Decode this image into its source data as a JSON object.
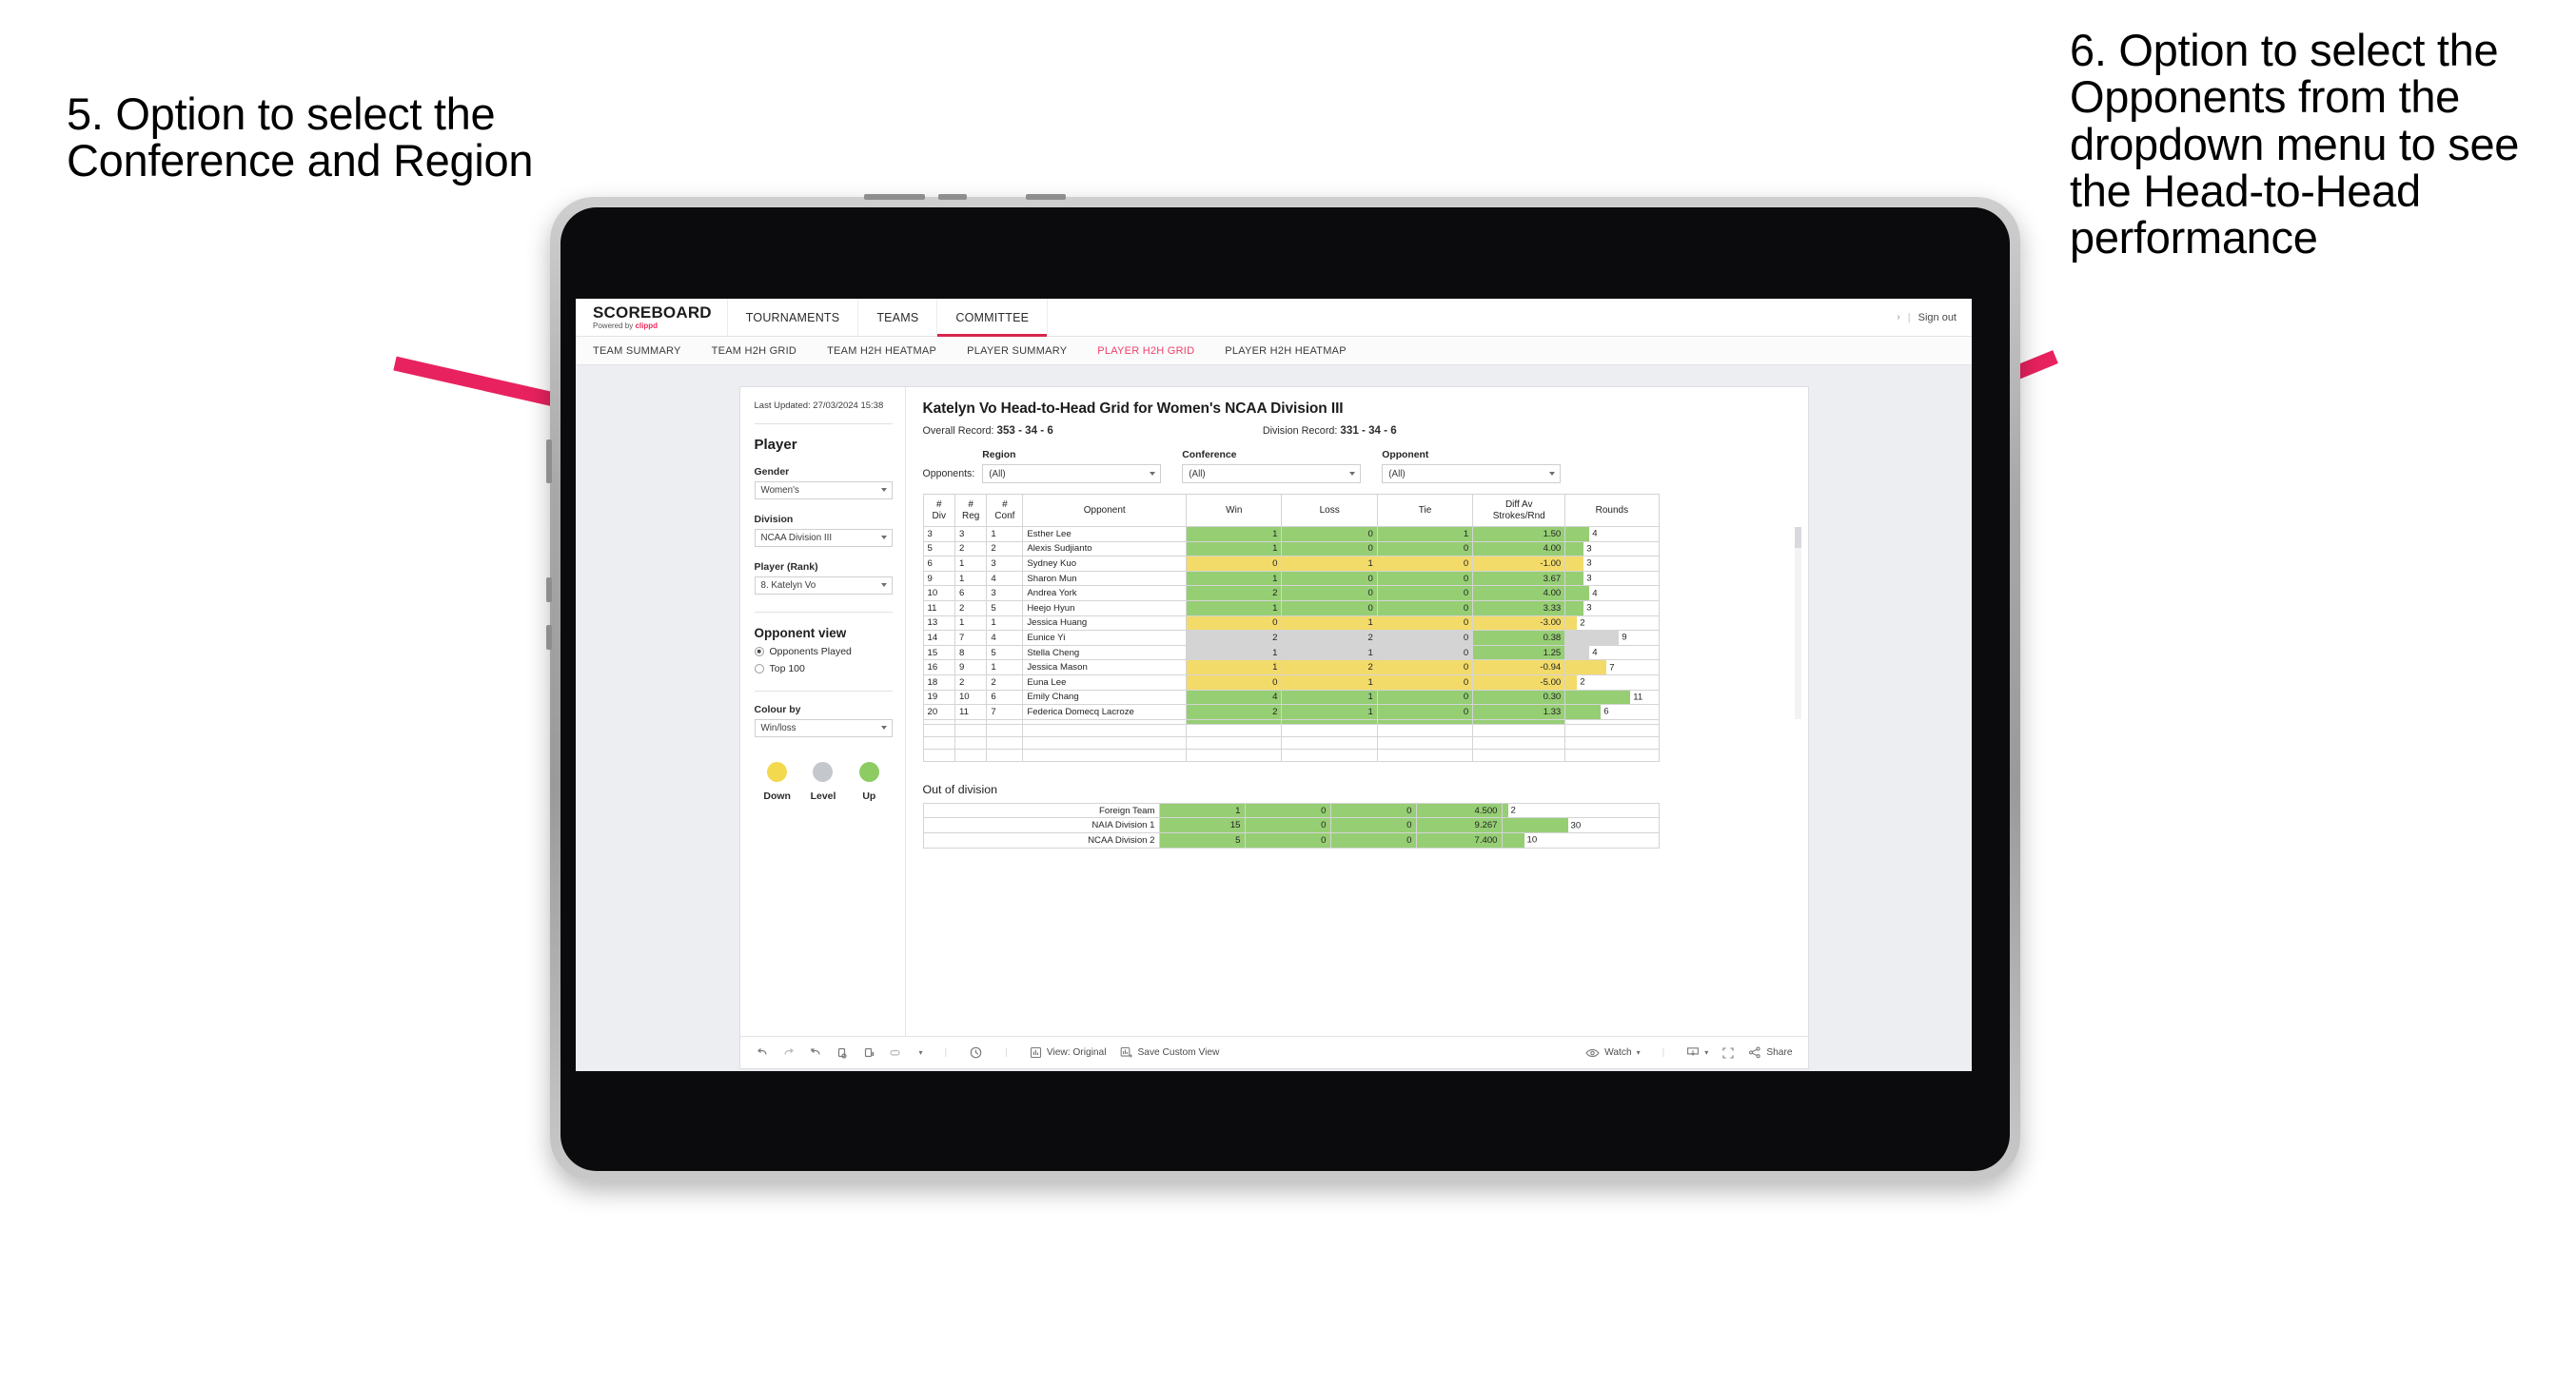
{
  "annotations": {
    "left": "5. Option to select the Conference and Region",
    "right": "6. Option to select the Opponents from the dropdown menu to see the Head-to-Head performance",
    "arrow_color": "#E8225E"
  },
  "app": {
    "brand": {
      "name": "SCOREBOARD",
      "powered_prefix": "Powered by ",
      "powered_by": "clippd"
    },
    "top_nav": [
      {
        "label": "TOURNAMENTS",
        "active": false
      },
      {
        "label": "TEAMS",
        "active": false
      },
      {
        "label": "COMMITTEE",
        "active": true
      }
    ],
    "top_right": {
      "chevron": "›",
      "separator": "|",
      "sign_out": "Sign out"
    },
    "sub_nav": [
      {
        "label": "TEAM SUMMARY",
        "active": false
      },
      {
        "label": "TEAM H2H GRID",
        "active": false
      },
      {
        "label": "TEAM H2H HEATMAP",
        "active": false
      },
      {
        "label": "PLAYER SUMMARY",
        "active": false
      },
      {
        "label": "PLAYER H2H GRID",
        "active": true
      },
      {
        "label": "PLAYER H2H HEATMAP",
        "active": false
      }
    ]
  },
  "sidebar": {
    "last_updated": "Last Updated: 27/03/2024 15:38",
    "heading": "Player",
    "gender": {
      "label": "Gender",
      "value": "Women's"
    },
    "division": {
      "label": "Division",
      "value": "NCAA Division III"
    },
    "player_rank": {
      "label": "Player (Rank)",
      "value": "8. Katelyn Vo"
    },
    "opponent_view": {
      "heading": "Opponent view",
      "options": [
        {
          "label": "Opponents Played",
          "selected": true
        },
        {
          "label": "Top 100",
          "selected": false
        }
      ]
    },
    "colour_by": {
      "label": "Colour by",
      "value": "Win/loss"
    },
    "legend": [
      {
        "label": "Down",
        "color": "#F2D94E"
      },
      {
        "label": "Level",
        "color": "#C4C7CB"
      },
      {
        "label": "Up",
        "color": "#8DCC62"
      }
    ]
  },
  "main": {
    "title": "Katelyn Vo Head-to-Head Grid for Women's NCAA Division III",
    "overall_record": {
      "label": "Overall Record: ",
      "value": "353 - 34 - 6"
    },
    "division_record": {
      "label": "Division Record: ",
      "value": "331 - 34 - 6"
    },
    "filters": {
      "prefix": "Opponents:",
      "items": [
        {
          "label": "Region",
          "value": "(All)"
        },
        {
          "label": "Conference",
          "value": "(All)"
        },
        {
          "label": "Opponent",
          "value": "(All)"
        }
      ]
    },
    "out_of_division_title": "Out of division"
  },
  "chart_data": {
    "type": "table",
    "title": "Katelyn Vo Head-to-Head Grid for Women's NCAA Division III",
    "columns": [
      "# Div",
      "# Reg",
      "# Conf",
      "Opponent",
      "Win",
      "Loss",
      "Tie",
      "Diff Av Strokes/Rnd",
      "Rounds"
    ],
    "column_headers_multiline": [
      {
        "l1": "#",
        "l2": "Div"
      },
      {
        "l1": "#",
        "l2": "Reg"
      },
      {
        "l1": "#",
        "l2": "Conf"
      },
      {
        "l1": "",
        "l2": "Opponent"
      },
      {
        "l1": "",
        "l2": "Win"
      },
      {
        "l1": "",
        "l2": "Loss"
      },
      {
        "l1": "",
        "l2": "Tie"
      },
      {
        "l1": "Diff Av",
        "l2": "Strokes/Rnd"
      },
      {
        "l1": "",
        "l2": "Rounds"
      }
    ],
    "rounds_max": 12,
    "rows": [
      {
        "div": "3",
        "reg": "3",
        "conf": "1",
        "opponent": "Esther Lee",
        "win": "1",
        "loss": "0",
        "tie": "1",
        "diff": "1.50",
        "rounds": 4,
        "state": "g"
      },
      {
        "div": "5",
        "reg": "2",
        "conf": "2",
        "opponent": "Alexis Sudjianto",
        "win": "1",
        "loss": "0",
        "tie": "0",
        "diff": "4.00",
        "rounds": 3,
        "state": "g"
      },
      {
        "div": "6",
        "reg": "1",
        "conf": "3",
        "opponent": "Sydney Kuo",
        "win": "0",
        "loss": "1",
        "tie": "0",
        "diff": "-1.00",
        "rounds": 3,
        "state": "y"
      },
      {
        "div": "9",
        "reg": "1",
        "conf": "4",
        "opponent": "Sharon Mun",
        "win": "1",
        "loss": "0",
        "tie": "0",
        "diff": "3.67",
        "rounds": 3,
        "state": "g"
      },
      {
        "div": "10",
        "reg": "6",
        "conf": "3",
        "opponent": "Andrea York",
        "win": "2",
        "loss": "0",
        "tie": "0",
        "diff": "4.00",
        "rounds": 4,
        "state": "g"
      },
      {
        "div": "11",
        "reg": "2",
        "conf": "5",
        "opponent": "Heejo Hyun",
        "win": "1",
        "loss": "0",
        "tie": "0",
        "diff": "3.33",
        "rounds": 3,
        "state": "g"
      },
      {
        "div": "13",
        "reg": "1",
        "conf": "1",
        "opponent": "Jessica Huang",
        "win": "0",
        "loss": "1",
        "tie": "0",
        "diff": "-3.00",
        "rounds": 2,
        "state": "y"
      },
      {
        "div": "14",
        "reg": "7",
        "conf": "4",
        "opponent": "Eunice Yi",
        "win": "2",
        "loss": "2",
        "tie": "0",
        "diff": "0.38",
        "rounds": 9,
        "state": "n",
        "diff_state": "g"
      },
      {
        "div": "15",
        "reg": "8",
        "conf": "5",
        "opponent": "Stella Cheng",
        "win": "1",
        "loss": "1",
        "tie": "0",
        "diff": "1.25",
        "rounds": 4,
        "state": "n",
        "diff_state": "g"
      },
      {
        "div": "16",
        "reg": "9",
        "conf": "1",
        "opponent": "Jessica Mason",
        "win": "1",
        "loss": "2",
        "tie": "0",
        "diff": "-0.94",
        "rounds": 7,
        "state": "y"
      },
      {
        "div": "18",
        "reg": "2",
        "conf": "2",
        "opponent": "Euna Lee",
        "win": "0",
        "loss": "1",
        "tie": "0",
        "diff": "-5.00",
        "rounds": 2,
        "state": "y"
      },
      {
        "div": "19",
        "reg": "10",
        "conf": "6",
        "opponent": "Emily Chang",
        "win": "4",
        "loss": "1",
        "tie": "0",
        "diff": "0.30",
        "rounds": 11,
        "state": "g"
      },
      {
        "div": "20",
        "reg": "11",
        "conf": "7",
        "opponent": "Federica Domecq Lacroze",
        "win": "2",
        "loss": "1",
        "tie": "0",
        "diff": "1.33",
        "rounds": 6,
        "state": "g"
      }
    ],
    "out_of_division": {
      "rounds_max": 32,
      "rows": [
        {
          "name": "Foreign Team",
          "win": "1",
          "loss": "0",
          "tie": "0",
          "diff": "4.500",
          "rounds": 2,
          "state": "g"
        },
        {
          "name": "NAIA Division 1",
          "win": "15",
          "loss": "0",
          "tie": "0",
          "diff": "9.267",
          "rounds": 30,
          "state": "g"
        },
        {
          "name": "NCAA Division 2",
          "win": "5",
          "loss": "0",
          "tie": "0",
          "diff": "7.400",
          "rounds": 10,
          "state": "g"
        }
      ]
    }
  },
  "toolbar": {
    "left_icons": [
      "undo-icon",
      "redo-icon",
      "revert-icon",
      "refresh-icon",
      "pause-icon",
      "highlight-icon"
    ],
    "view_label": "View: Original",
    "save_label": "Save Custom View",
    "watch_label": "Watch",
    "share_label": "Share"
  }
}
